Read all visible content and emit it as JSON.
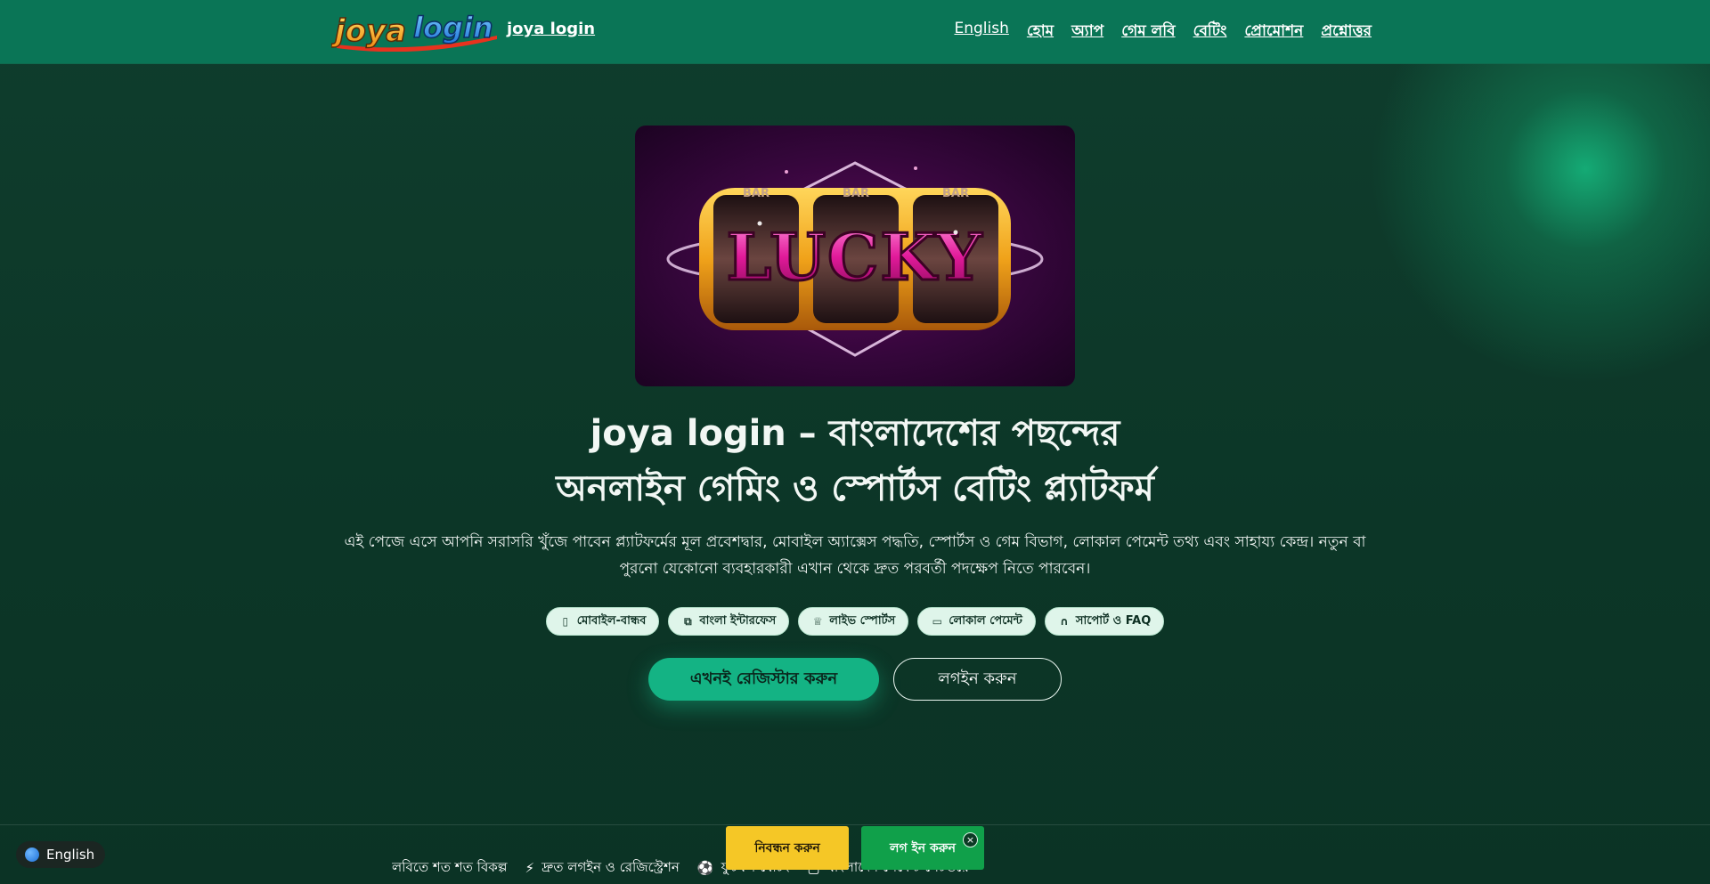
{
  "header": {
    "logo_text": "joya login",
    "brand_link": "joya login",
    "nav": [
      {
        "label": "English",
        "icon": ""
      },
      {
        "label": "হোম"
      },
      {
        "label": "অ্যাপ"
      },
      {
        "label": "গেম লবি"
      },
      {
        "label": "বেটিং"
      },
      {
        "label": "প্রোমোশন"
      },
      {
        "label": "প্রশ্নোত্তর"
      }
    ]
  },
  "hero": {
    "image_text": "LUCKY",
    "reel_labels": [
      "BAR",
      "BAR",
      "BAR"
    ],
    "title_line1": "joya login – বাংলাদেশের পছন্দের",
    "title_line2": "অনলাইন গেমিং ও স্পোর্টস বেটিং প্ল্যাটফর্ম",
    "description": "এই পেজে এসে আপনি সরাসরি খুঁজে পাবেন প্ল্যাটফর্মের মূল প্রবেশদ্বার, মোবাইল অ্যাক্সেস পদ্ধতি, স্পোর্টস ও গেম বিভাগ, লোকাল পেমেন্ট তথ্য এবং সাহায্য কেন্দ্র। নতুন বা পুরনো যেকোনো ব্যবহারকারী এখান থেকে দ্রুত পরবর্তী পদক্ষেপ নিতে পারবেন।",
    "chips": [
      {
        "label": "মোবাইল-বান্ধব",
        "icon": "mobile-icon"
      },
      {
        "label": "বাংলা ইন্টারফেস",
        "icon": "translate-icon"
      },
      {
        "label": "লাইভ স্পোর্টস",
        "icon": "trophy-icon"
      },
      {
        "label": "লোকাল পেমেন্ট",
        "icon": "card-icon"
      },
      {
        "label": "সাপোর্ট ও FAQ",
        "icon": "headset-icon"
      }
    ],
    "register_button": "এখনই রেজিস্টার করুন",
    "login_button": "লগইন করুন"
  },
  "ticker": {
    "items": [
      {
        "label": "লবিতে শত শত বিকল্প",
        "icon": ""
      },
      {
        "label": "দ্রুত লগইন ও রেজিস্ট্রেশন",
        "icon": "bolt-icon"
      },
      {
        "label": "ফুটবল বেটিং",
        "icon": "ball-icon"
      },
      {
        "label": "বাংলাদেশ পেমেন্ট গেটওয়ে",
        "icon": "wallet-icon"
      }
    ]
  },
  "sticky": {
    "register": "নিবন্ধন করুন",
    "login": "লগ ইন করুন",
    "close": "×"
  },
  "language_pill": {
    "label": "English"
  },
  "colors": {
    "header_bg": "#0a7556",
    "page_bg": "#0d3a2b",
    "primary_cta": "#14b384",
    "sticky_register": "#f5c726",
    "sticky_login": "#10a04a"
  }
}
